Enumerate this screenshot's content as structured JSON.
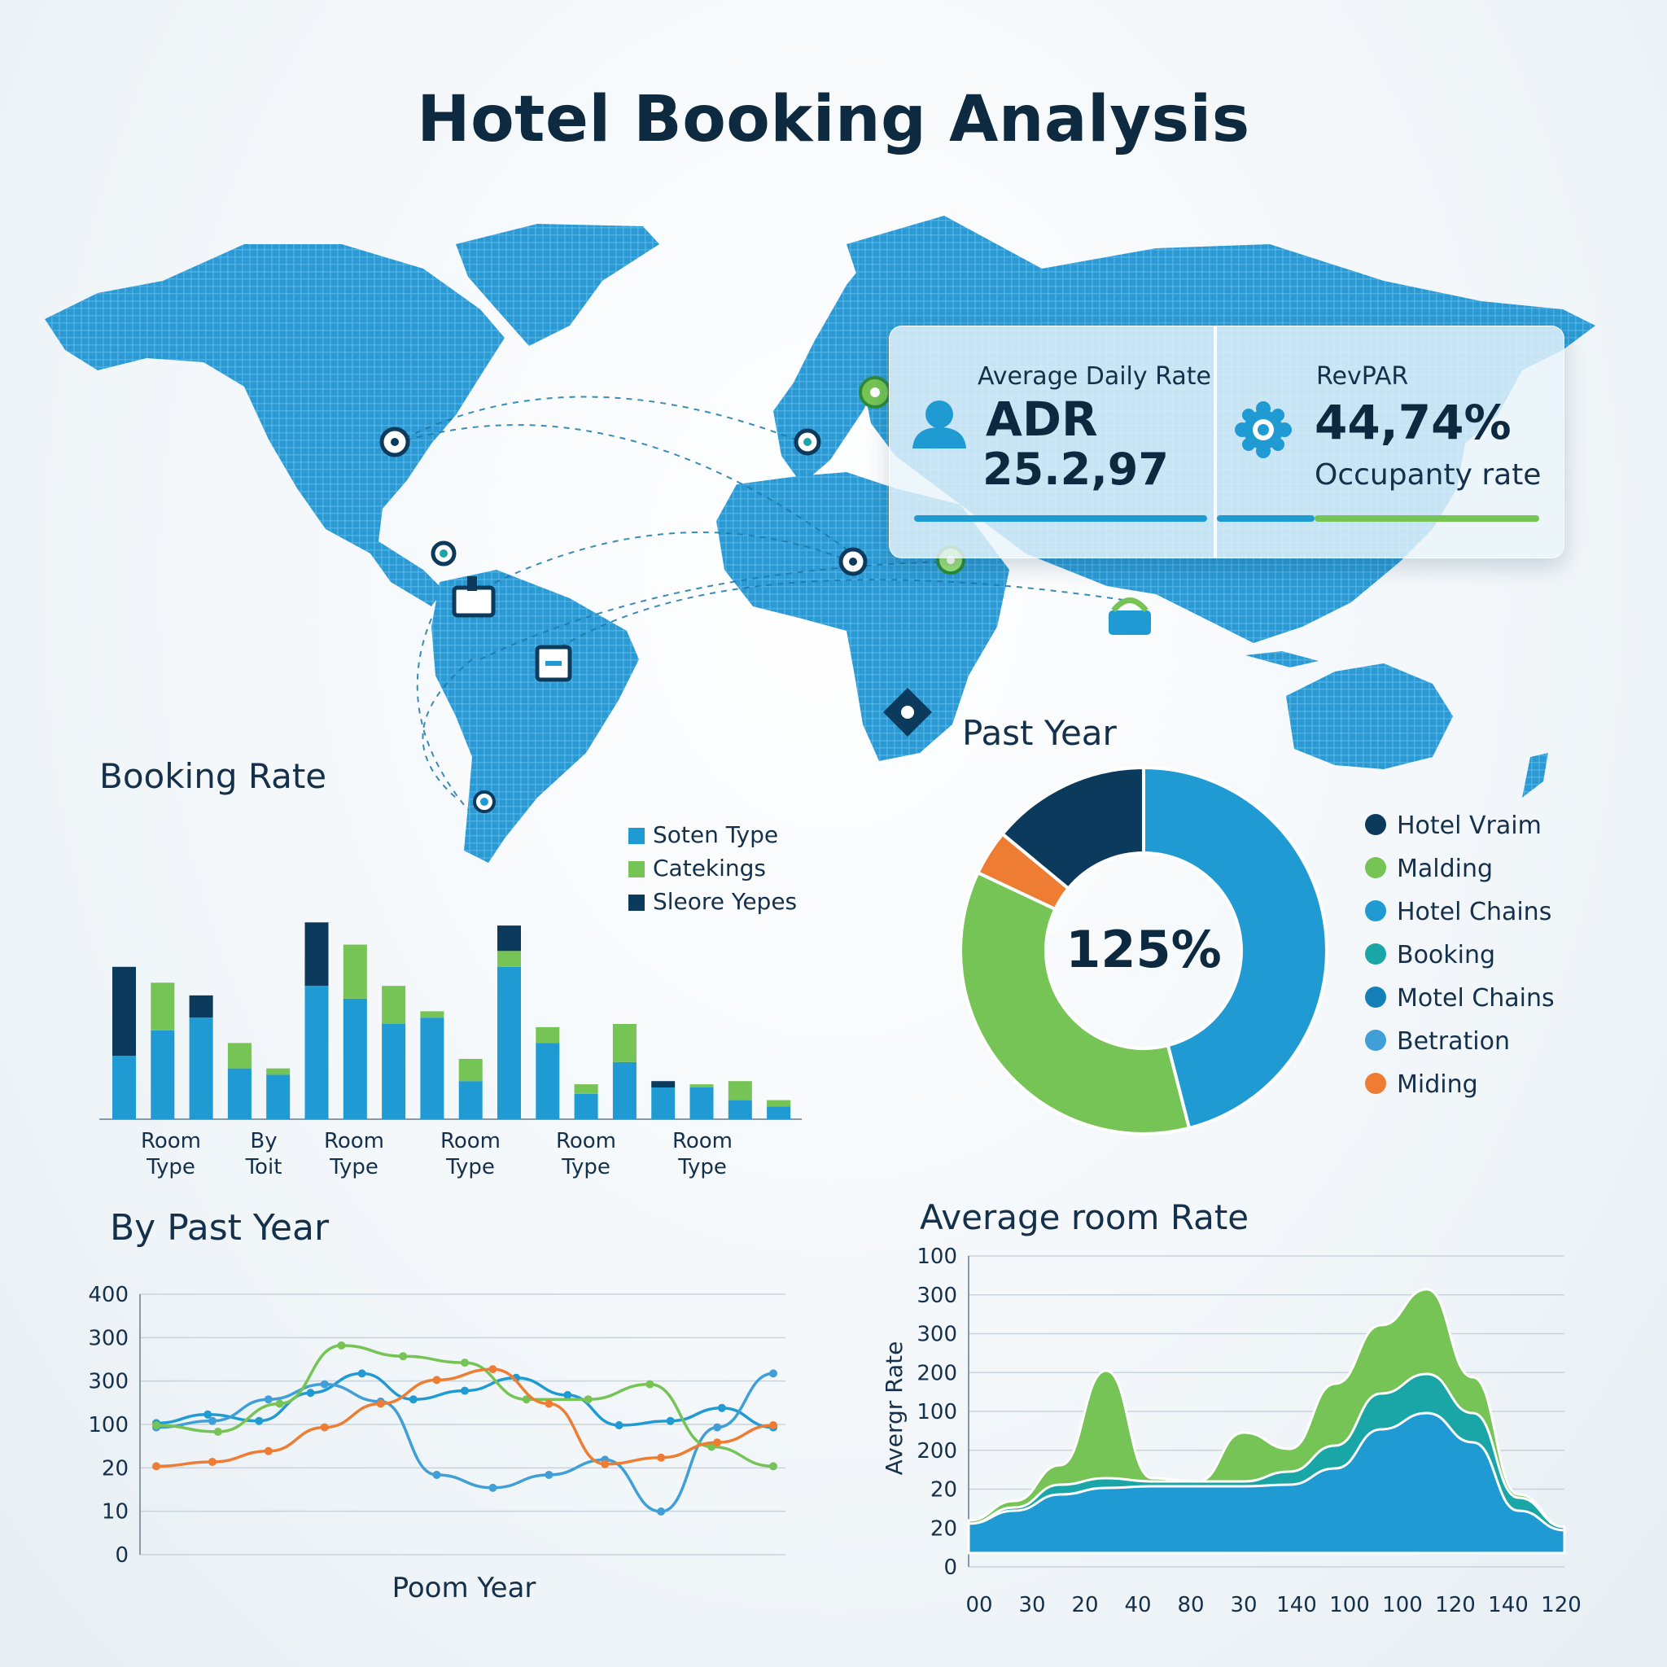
{
  "title": "Hotel Booking Analysis",
  "colors": {
    "navy": "#0b3a5c",
    "blue": "#1f9ad2",
    "green": "#76c356",
    "orange": "#ee7d33",
    "teal": "#1aa6a6",
    "steel": "#3f9fd6",
    "map": "#2b9ad4"
  },
  "kpis": {
    "adr_label": "Average Daily Rate",
    "adr_code": "ADR",
    "adr_value": "25.2,97",
    "revpar_label": "RevPAR",
    "revpar_value": "44,74%",
    "revpar_sub": "Occupanty rate"
  },
  "map_icons": [
    "location-pin-icon",
    "hotel-icon",
    "luggage-icon",
    "briefcase-icon",
    "compass-icon",
    "bag-icon"
  ],
  "chart_data": [
    {
      "type": "bar",
      "title": "Booking Rate",
      "legend": [
        "Soten Type",
        "Catekings",
        "Sleore Yepes"
      ],
      "tick_labels": [
        [
          "Room",
          "Type"
        ],
        [
          "By",
          "Toit"
        ],
        [
          "Room",
          "Type"
        ],
        [
          "Room",
          "Type"
        ],
        [
          "Room",
          "Type"
        ],
        [
          "Room",
          "Type"
        ]
      ],
      "series": [
        {
          "values": [
            1.0,
            1.4,
            1.6,
            0.8,
            0.7,
            2.1,
            1.9,
            1.5,
            1.6,
            0.6,
            2.4,
            1.2,
            0.4,
            0.9,
            0.5,
            0.5,
            0.3,
            0.2
          ]
        },
        {
          "values": [
            0,
            0.75,
            0,
            0.4,
            0.1,
            0,
            0.85,
            0.6,
            0.1,
            0.35,
            0.25,
            0.25,
            0.15,
            0.6,
            0,
            0.05,
            0.3,
            0.1
          ]
        },
        {
          "values": [
            1.4,
            0,
            0.35,
            0,
            0,
            1.0,
            0,
            0,
            0,
            0,
            0.4,
            0,
            0,
            0,
            0.1,
            0,
            0,
            0
          ]
        }
      ]
    },
    {
      "type": "pie",
      "title": "Past Year",
      "center_label": "125%",
      "slices": [
        {
          "label": "Hotel Chains",
          "value": 46
        },
        {
          "label": "Malding",
          "value": 36
        },
        {
          "label": "Miding",
          "value": 4
        },
        {
          "label": "Hotel Vraim",
          "value": 14
        }
      ],
      "legend": [
        "Hotel Vraim",
        "Malding",
        "Hotel Chains",
        "Booking",
        "Motel Chains",
        "Betration",
        "Miding"
      ]
    },
    {
      "type": "line",
      "title": "By Past Year",
      "xlabel": "Poom Year",
      "yticks": [
        "400",
        "300",
        "300",
        "100",
        "20",
        "10",
        "0"
      ],
      "series": [
        {
          "values": [
            3.05,
            3.25,
            3.1,
            3.75,
            4.2,
            3.6,
            3.8,
            4.1,
            3.7,
            3.0,
            3.1,
            3.4,
            2.95
          ]
        },
        {
          "values": [
            2.95,
            3.1,
            3.6,
            3.95,
            3.55,
            1.85,
            1.55,
            1.85,
            2.2,
            1.0,
            2.95,
            4.2
          ]
        },
        {
          "values": [
            3.0,
            2.85,
            3.5,
            4.85,
            4.6,
            4.45,
            3.6,
            3.6,
            3.95,
            2.5,
            2.05
          ]
        },
        {
          "values": [
            2.05,
            2.15,
            2.4,
            2.95,
            3.5,
            4.05,
            4.3,
            3.5,
            2.1,
            2.25,
            2.6,
            3.0
          ]
        }
      ]
    },
    {
      "type": "area",
      "title": "Average room Rate",
      "ylabel": "Avergr Rate",
      "yticks": [
        "100",
        "300",
        "300",
        "200",
        "100",
        "200",
        "20",
        "20",
        "0"
      ],
      "xticks": [
        "00",
        "30",
        "20",
        "40",
        "80",
        "30",
        "140",
        "100",
        "100",
        "120",
        "140",
        "120"
      ],
      "series": [
        {
          "values": [
            0.9,
            1.3,
            1.8,
            2.0,
            2.05,
            2.05,
            2.05,
            2.1,
            2.6,
            3.8,
            4.3,
            3.4,
            1.3,
            0.7
          ]
        },
        {
          "values": [
            0.9,
            1.4,
            2.1,
            2.3,
            2.2,
            2.2,
            2.2,
            2.5,
            3.3,
            4.9,
            5.5,
            4.3,
            1.7,
            0.8
          ]
        },
        {
          "values": [
            1.0,
            1.6,
            2.7,
            5.6,
            2.3,
            2.2,
            3.7,
            3.2,
            5.2,
            7.0,
            8.1,
            5.4,
            1.8,
            0.8
          ]
        }
      ]
    }
  ]
}
